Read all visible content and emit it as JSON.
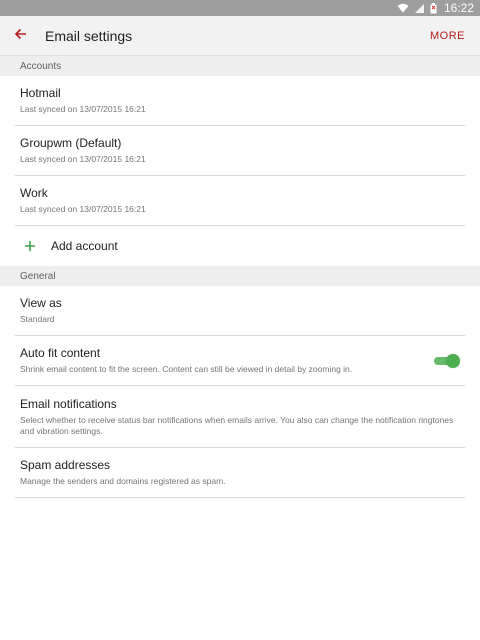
{
  "status_bar": {
    "time": "16:22"
  },
  "app_bar": {
    "title": "Email settings",
    "more_label": "MORE"
  },
  "sections": {
    "accounts_header": "Accounts",
    "general_header": "General"
  },
  "accounts": [
    {
      "name": "Hotmail",
      "synced": "Last synced on 13/07/2015 16:21"
    },
    {
      "name": "Groupwm (Default)",
      "synced": "Last synced on 13/07/2015 16:21"
    },
    {
      "name": "Work",
      "synced": "Last synced on 13/07/2015 16:21"
    }
  ],
  "add_account_label": "Add account",
  "general": {
    "view_as": {
      "title": "View as",
      "value": "Standard"
    },
    "auto_fit": {
      "title": "Auto fit content",
      "description": "Shrink email content to fit the screen. Content can still be viewed in detail by zooming in.",
      "enabled": true
    },
    "email_notifications": {
      "title": "Email notifications",
      "description": "Select whether to receive status bar notifications when emails arrive. You also can change the notification ringtones and vibration settings."
    },
    "spam": {
      "title": "Spam addresses",
      "description": "Manage the senders and domains registered as spam."
    }
  },
  "colors": {
    "accent": "#b71c1c",
    "toggle_on": "#4caf50",
    "add_icon": "#43a047",
    "status_bar": "#9e9e9e"
  }
}
